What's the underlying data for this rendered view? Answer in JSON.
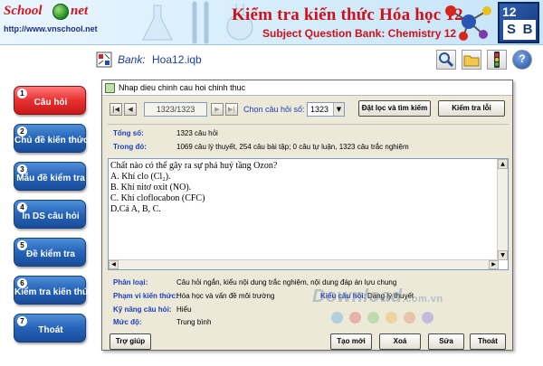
{
  "header": {
    "logo_word_1": "School",
    "logo_word_2": "net",
    "url": "http://www.vnschool.net",
    "title": "Kiểm tra kiến thức Hóa học 12",
    "subtitle": "Subject Question Bank: Chemistry 12",
    "badge_number": "12",
    "badge_letter_1": "S",
    "badge_letter_2": "B",
    "colors": {
      "title": "#d0101a",
      "badge": "#163a7c"
    }
  },
  "sidebar": {
    "items": [
      {
        "number": "1",
        "label": "Câu hỏi",
        "active": true
      },
      {
        "number": "2",
        "label": "Chủ đề kiến thức",
        "active": false
      },
      {
        "number": "3",
        "label": "Mẫu đề kiểm tra",
        "active": false
      },
      {
        "number": "4",
        "label": "In DS câu hỏi",
        "active": false
      },
      {
        "number": "5",
        "label": "Đề kiểm tra",
        "active": false
      },
      {
        "number": "6",
        "label": "Kiểm tra kiến thức",
        "active": false
      },
      {
        "number": "7",
        "label": "Thoát",
        "active": false
      }
    ],
    "colors": {
      "normal": "#2563b8",
      "active": "#e83030"
    }
  },
  "bankbar": {
    "label": "Bank:",
    "file": "Hoa12.iqb",
    "tools": [
      "search-icon",
      "folder-icon",
      "traffic-light-icon",
      "help-icon"
    ],
    "help_glyph": "?"
  },
  "dialog": {
    "title": "Nhap dieu chinh cau hoi chinh thuc",
    "nav": {
      "first": "|◀",
      "prev": "◀",
      "next": "▶",
      "last": "▶|",
      "position": "1323/1323",
      "choose_label": "Chọn câu hỏi số:",
      "choose_value": "1323",
      "filter_button": "Đặt lọc và tìm kiếm",
      "check_button": "Kiểm tra lỗi"
    },
    "info": {
      "total_label": "Tổng số:",
      "total_value": "1323 câu hỏi",
      "of_which_label": "Trong đó:",
      "of_which_value": "1069 câu lý thuyết, 254 câu bài tập; 0 câu tự luận, 1323 câu trắc nghiệm"
    },
    "question": {
      "lines": [
        "Chất nào có thể gây ra sự phá huỷ tầng Ozon?",
        "A. Khí clo (Cl₂).",
        "B. Khí nitơ oxit (NO).",
        "C. Khí cloflocabon (CFC)",
        "D.Cả A, B, C."
      ]
    },
    "meta": {
      "category_label": "Phân loại:",
      "category_value": "Câu hỏi ngắn, kiểu nội dung trắc nghiệm, nội dung đáp án lựu chung",
      "scope_label": "Phạm vi kiến thức:",
      "scope_value": "Hóa học và vấn đề môi trường",
      "type_label": "Kiểu câu hỏi:",
      "type_value": "Dạng lý thuyết",
      "skill_label": "Kỹ năng câu hỏi:",
      "skill_value": "Hiểu",
      "level_label": "Mức độ:",
      "level_value": "Trung bình"
    },
    "buttons": {
      "help": "Trợ giúp",
      "new": "Tạo mới",
      "delete": "Xoá",
      "edit": "Sửa",
      "exit": "Thoát"
    }
  },
  "watermark": {
    "text": "Download",
    "domain": ".com.vn",
    "dot_colors": [
      "#7ab3e0",
      "#e07a7a",
      "#8fcf7a",
      "#f0c060",
      "#e0a07a",
      "#9a8fe0"
    ]
  }
}
